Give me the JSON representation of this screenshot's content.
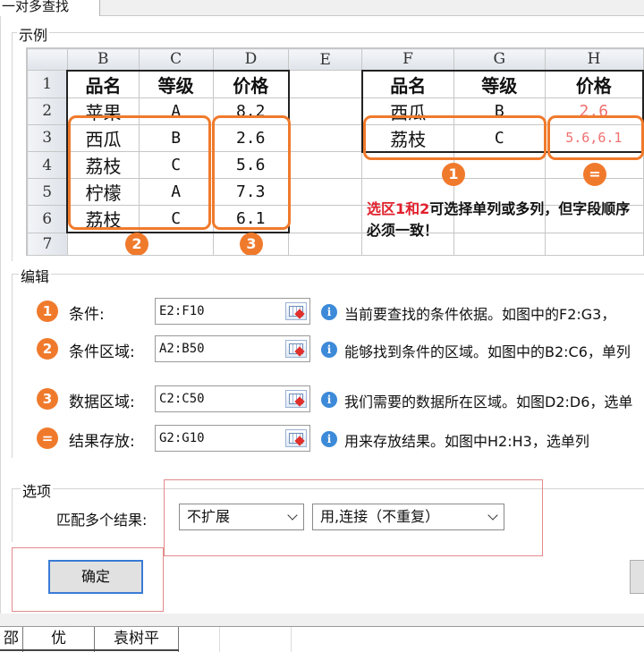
{
  "tab": {
    "title": "一对多查找"
  },
  "example": {
    "legend": "示例",
    "col_letters": [
      "B",
      "C",
      "D",
      "E",
      "F",
      "G",
      "H"
    ],
    "row_numbers": [
      "1",
      "2",
      "3",
      "4",
      "5",
      "6",
      "7"
    ],
    "headers": {
      "name": "品名",
      "grade": "等级",
      "price": "价格"
    },
    "rows": [
      {
        "name": "苹果",
        "grade": "A",
        "price": "8.2"
      },
      {
        "name": "西瓜",
        "grade": "B",
        "price": "2.6"
      },
      {
        "name": "荔枝",
        "grade": "C",
        "price": "5.6"
      },
      {
        "name": "柠檬",
        "grade": "A",
        "price": "7.3"
      },
      {
        "name": "荔枝",
        "grade": "C",
        "price": "6.1"
      }
    ],
    "right_rows": [
      {
        "name": "西瓜",
        "grade": "B",
        "price": "2.6"
      },
      {
        "name": "荔枝",
        "grade": "C",
        "price": "5.6,6.1"
      }
    ],
    "markers": {
      "one": "1",
      "two": "2",
      "three": "3",
      "equals": "="
    },
    "note_highlight": "选区1和2",
    "note_rest": "可选择单列或多列，但字段顺序必须一致！",
    "accent_color": "#f07a2c",
    "note_color": "#e0202c"
  },
  "edit": {
    "legend": "编辑",
    "rows": [
      {
        "marker": "1",
        "label": "条件:",
        "value": "E2:F10",
        "desc": "当前要查找的条件依据。如图中的F2:G3，"
      },
      {
        "marker": "2",
        "label": "条件区域:",
        "value": "A2:B50",
        "desc": "能够找到条件的区域。如图中的B2:C6，单列"
      },
      {
        "marker": "3",
        "label": "数据区域:",
        "value": "C2:C50",
        "desc": "我们需要的数据所在区域。如图D2:D6，选单"
      },
      {
        "marker": "=",
        "label": "结果存放:",
        "value": "G2:G10",
        "desc": "用来存放结果。如图中H2:H3，选单列"
      }
    ],
    "info_glyph": "i"
  },
  "options": {
    "legend": "选项",
    "label": "匹配多个结果:",
    "select1": "不扩展",
    "select2": "用,连接（不重复）"
  },
  "buttons": {
    "ok": "确定"
  },
  "bottom_sheet": {
    "cells": [
      "邵",
      "优",
      "袁树平"
    ]
  }
}
